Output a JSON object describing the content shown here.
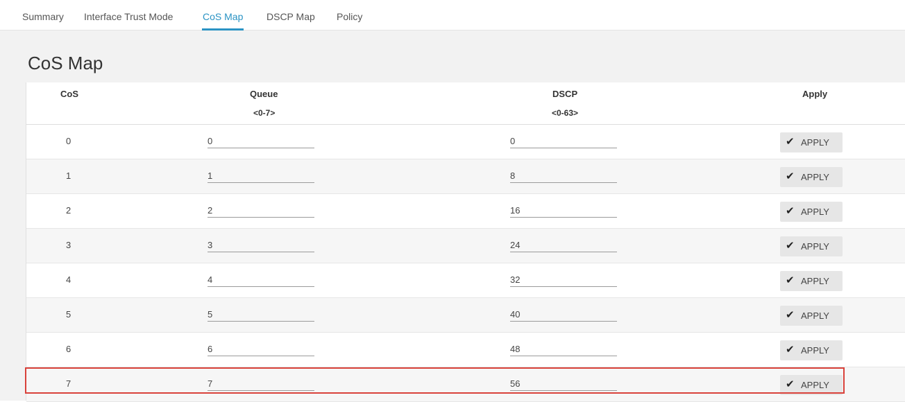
{
  "tabs": [
    {
      "label": "Summary",
      "active": false
    },
    {
      "label": "Interface Trust Mode",
      "active": false
    },
    {
      "label": "CoS Map",
      "active": true
    },
    {
      "label": "DSCP Map",
      "active": false
    },
    {
      "label": "Policy",
      "active": false
    }
  ],
  "page": {
    "title": "CoS Map"
  },
  "table": {
    "headers": {
      "cos": "CoS",
      "queue": "Queue",
      "queue_range": "<0-7>",
      "dscp": "DSCP",
      "dscp_range": "<0-63>",
      "apply": "Apply"
    },
    "apply_label": "APPLY",
    "rows": [
      {
        "cos": "0",
        "queue": "0",
        "dscp": "0"
      },
      {
        "cos": "1",
        "queue": "1",
        "dscp": "8"
      },
      {
        "cos": "2",
        "queue": "2",
        "dscp": "16"
      },
      {
        "cos": "3",
        "queue": "3",
        "dscp": "24"
      },
      {
        "cos": "4",
        "queue": "4",
        "dscp": "32"
      },
      {
        "cos": "5",
        "queue": "5",
        "dscp": "40"
      },
      {
        "cos": "6",
        "queue": "6",
        "dscp": "48"
      },
      {
        "cos": "7",
        "queue": "7",
        "dscp": "56"
      }
    ]
  },
  "icons": {
    "apply": "check-icon"
  },
  "colors": {
    "accent": "#2a93c4",
    "highlight": "#d9413a"
  }
}
